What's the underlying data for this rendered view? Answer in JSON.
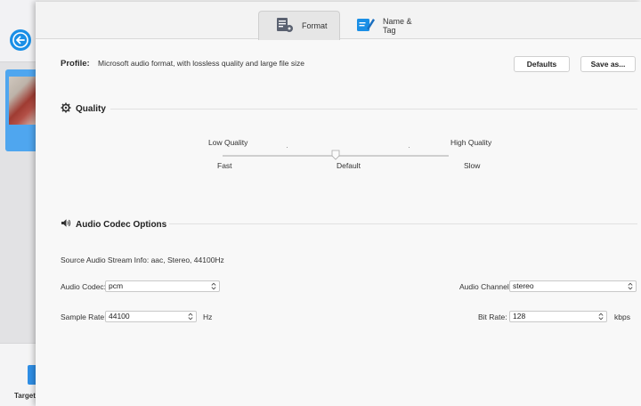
{
  "background_app": {
    "target_label": "Target"
  },
  "tabs": [
    {
      "label": "Format",
      "icon": "format-settings-icon",
      "active": true
    },
    {
      "label": "Name & Tag",
      "icon": "edit-tag-icon",
      "active": false
    }
  ],
  "profile": {
    "label": "Profile:",
    "description": "Microsoft audio format, with lossless quality and large file size",
    "defaults_button": "Defaults",
    "save_as_button": "Save as..."
  },
  "quality": {
    "title": "Quality",
    "icon": "gear-icon",
    "left_top": "Low Quality",
    "right_top": "High Quality",
    "left_bottom": "Fast",
    "center_bottom": "Default",
    "right_bottom": "Slow",
    "slider_position": 0.5
  },
  "audio": {
    "title": "Audio Codec Options",
    "icon": "speaker-icon",
    "source_info": "Source Audio Stream Info: aac, Stereo, 44100Hz",
    "codec_label": "Audio Codec:",
    "codec_value": "pcm",
    "channel_label": "Audio Channel:",
    "channel_value": "stereo",
    "sample_rate_label": "Sample Rate:",
    "sample_rate_value": "44100",
    "sample_rate_unit": "Hz",
    "bit_rate_label": "Bit Rate:",
    "bit_rate_value": "128",
    "bit_rate_unit": "kbps"
  },
  "colors": {
    "accent": "#1a8fe6",
    "panel": "#f8f8f8"
  }
}
